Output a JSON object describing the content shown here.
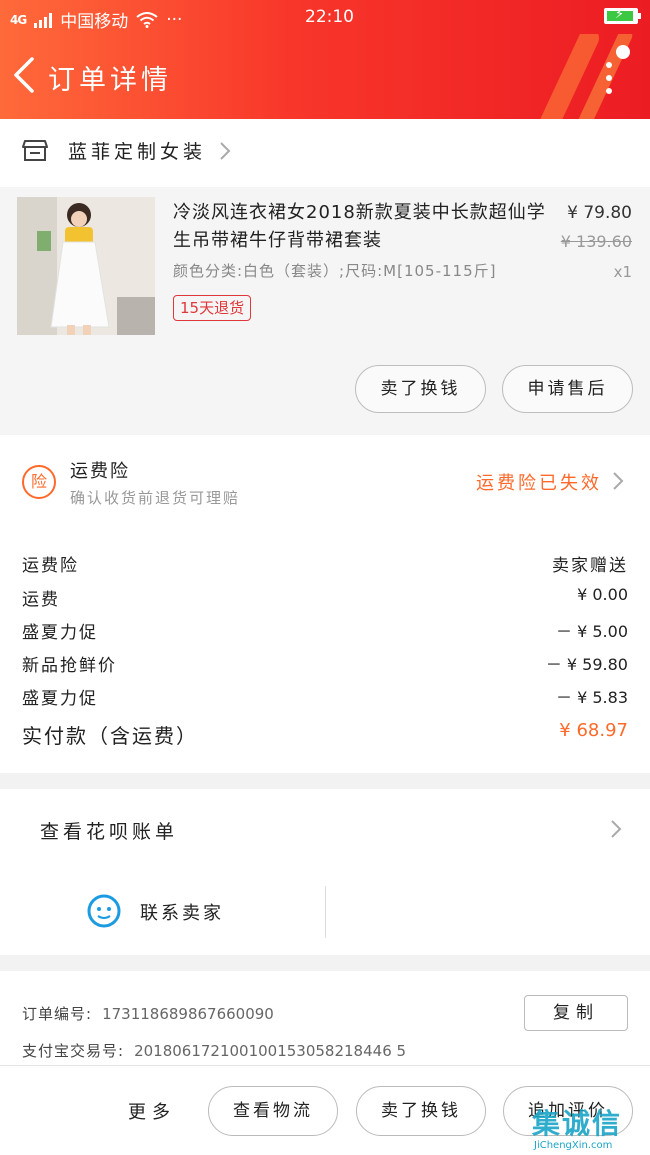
{
  "status_bar": {
    "network": "4G",
    "carrier": "中国移动",
    "extra": "···",
    "time": "22:10"
  },
  "header": {
    "title": "订单详情"
  },
  "store": {
    "name": "蓝菲定制女装"
  },
  "product": {
    "title": "冷淡风连衣裙女2018新款夏装中长款超仙学生吊带裙牛仔背带裙套装",
    "spec": "颜色分类:白色（套装）;尺码:M[105-115斤]",
    "price": "¥ 79.80",
    "original_price": "¥ 139.60",
    "quantity": "x1",
    "return_tag": "15天退货",
    "button_refund": "卖了换钱",
    "button_after_sale": "申请售后"
  },
  "insurance": {
    "icon_label": "险",
    "title": "运费险",
    "subtitle": "确认收货前退货可理赔",
    "status": "运费险已失效"
  },
  "fees": [
    {
      "label": "运费险",
      "value": "卖家赠送"
    },
    {
      "label": "运费",
      "value": "¥ 0.00"
    },
    {
      "label": "盛夏力促",
      "value": "－ ¥ 5.00"
    },
    {
      "label": "新品抢鲜价",
      "value": "－ ¥ 59.80"
    },
    {
      "label": "盛夏力促",
      "value": "－ ¥ 5.83"
    }
  ],
  "total": {
    "label": "实付款（含运费）",
    "value": "¥ 68.97"
  },
  "huabei": {
    "label": "查看花呗账单"
  },
  "contact": {
    "label": "联系卖家"
  },
  "order_info": {
    "order_no_label": "订单编号:",
    "order_no": "173118689867660090",
    "alipay_label": "支付宝交易号:",
    "alipay_no": "201806172100100153058218446 5",
    "copy": "复制"
  },
  "bottom_bar": {
    "more": "更多",
    "logistics": "查看物流",
    "sell": "卖了换钱",
    "review": "追加评价"
  },
  "watermark": {
    "logo": "集诚信",
    "url": "JiChengXin.com"
  },
  "colors": {
    "header_red": "#ec1c23",
    "accent_orange": "#ff6a2b",
    "battery_green": "#3dc844",
    "contact_blue": "#1d9be0"
  }
}
